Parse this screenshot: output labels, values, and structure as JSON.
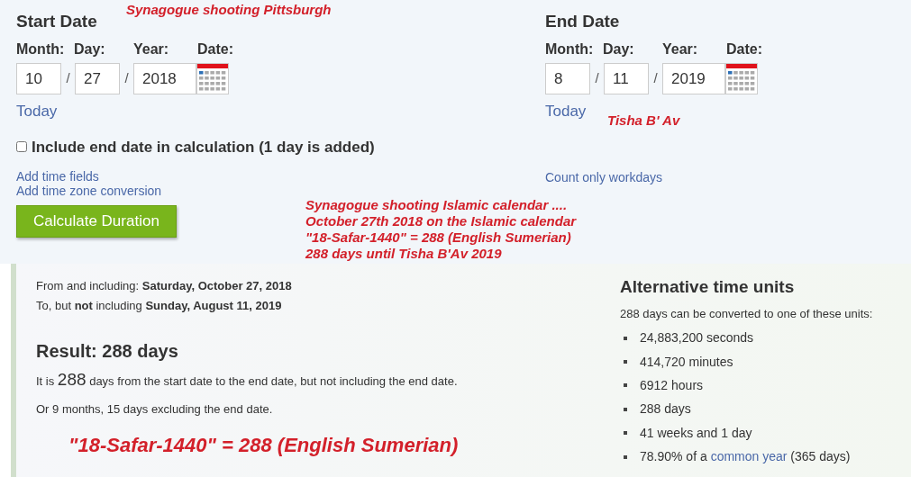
{
  "start_date": {
    "heading": "Start Date",
    "labels": [
      "Month:",
      "Day:",
      "Year:",
      "Date:"
    ],
    "month": "10",
    "day": "27",
    "year": "2018",
    "separator": "/",
    "today_link": "Today"
  },
  "end_date": {
    "heading": "End Date",
    "labels": [
      "Month:",
      "Day:",
      "Year:",
      "Date:"
    ],
    "month": "8",
    "day": "11",
    "year": "2019",
    "separator": "/",
    "today_link": "Today"
  },
  "include_end_date": {
    "label": "Include end date in calculation (1 day is added)",
    "checked": false
  },
  "left_links": [
    "Add time fields",
    "Add time zone conversion"
  ],
  "right_links": [
    "Count only workdays"
  ],
  "calculate_button": "Calculate Duration",
  "annotations": [
    {
      "lines": [
        "Synagogue shooting Pittsburgh"
      ]
    },
    {
      "lines": [
        "Tisha B' Av"
      ]
    },
    {
      "lines": [
        "Synagogue shooting Islamic calendar ....",
        "October 27th 2018 on the Islamic calendar",
        "\"18-Safar-1440\" = 288 (English Sumerian)",
        "288 days until Tisha B'Av 2019"
      ]
    }
  ],
  "result": {
    "from_line": "From and including: **Saturday, October 27, 2018**",
    "to_line": "To, but **not** including **Sunday, August 11, 2019**",
    "heading": "Result: 288 days",
    "sentence": {
      "before": "It is",
      "number": "288",
      "after": "days from the start date to the end date, but not including the end date."
    },
    "months_line": "Or 9 months, 15 days excluding the end date.",
    "annotation": "\"18-Safar-1440\" = 288 (English Sumerian)"
  },
  "alternative_units": {
    "heading": "Alternative time units",
    "intro": "288 days can be converted to one of these units:",
    "items": [
      {
        "text": "24,883,200 seconds"
      },
      {
        "text": "414,720 minutes"
      },
      {
        "text": "6912 hours"
      },
      {
        "text": "288 days"
      },
      {
        "text": "41 weeks and 1 day"
      },
      {
        "text": "78.90% of a",
        "link": "common year",
        "after": "(365 days)"
      }
    ]
  }
}
